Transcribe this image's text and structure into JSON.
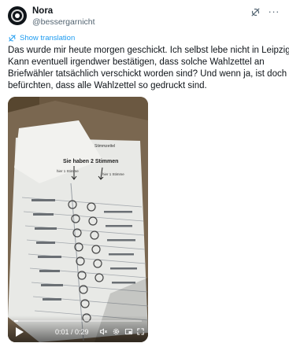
{
  "author": {
    "name": "Nora",
    "handle": "@bessergarnicht"
  },
  "icons": {
    "avatar": "avatar-image",
    "grok": "grok-icon",
    "more": "more-icon",
    "translate": "translate-icon"
  },
  "more_glyph": "···",
  "translation": {
    "label": "Show translation"
  },
  "tweet": {
    "lines": [
      "Das wurde mir heute morgen geschickt. Ich selbst lebe nicht in Leipzig.",
      "Kann eventuell irgendwer bestätigen, dass solche Wahlzettel an",
      "Briefwähler tatsächlich verschickt worden sind? Und wenn ja, ist doch zu",
      "befürchten, dass alle Wahlzettel so gedruckt sind."
    ]
  },
  "video": {
    "time": "0:01 / 0:29",
    "progress": 0.03,
    "ballot": {
      "title": "Stimmzettel",
      "headline": "Sie haben 2 Stimmen",
      "first_vote": "hier 1 Stimme",
      "second_vote": "hier 1 Stimme"
    }
  },
  "colors": {
    "accent": "#1d9bf0",
    "text": "#0f1419",
    "muted": "#536471"
  }
}
